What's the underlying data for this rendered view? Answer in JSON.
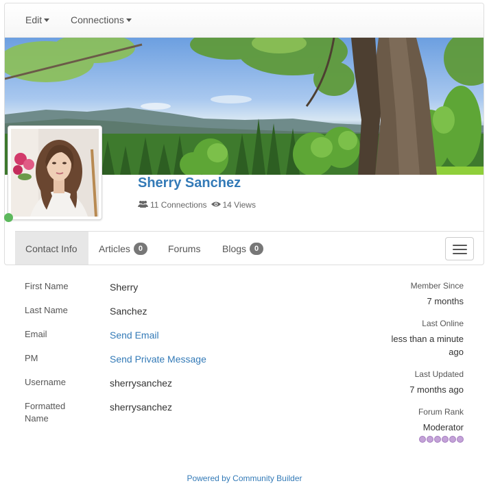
{
  "nav": {
    "edit_label": "Edit",
    "connections_label": "Connections"
  },
  "profile": {
    "name": "Sherry Sanchez",
    "connections_text": "11 Connections",
    "views_text": "14 Views",
    "online": true
  },
  "tabs": [
    {
      "label": "Contact Info",
      "badge": null,
      "active": true
    },
    {
      "label": "Articles",
      "badge": "0",
      "active": false
    },
    {
      "label": "Forums",
      "badge": null,
      "active": false
    },
    {
      "label": "Blogs",
      "badge": "0",
      "active": false
    }
  ],
  "fields": [
    {
      "label": "First Name",
      "value": "Sherry"
    },
    {
      "label": "Last Name",
      "value": "Sanchez"
    },
    {
      "label": "Email",
      "value": "Send Email"
    },
    {
      "label": "PM",
      "value": "Send Private Message"
    },
    {
      "label": "Username",
      "value": "sherrysanchez"
    },
    {
      "label": "Formatted Name",
      "value": "sherrysanchez"
    }
  ],
  "sidebar": {
    "member_since_label": "Member Since",
    "member_since_value": "7 months",
    "last_online_label": "Last Online",
    "last_online_value": "less than a minute ago",
    "last_updated_label": "Last Updated",
    "last_updated_value": "7 months ago",
    "forum_rank_label": "Forum Rank",
    "forum_rank_value": "Moderator",
    "rank_stars": 6
  },
  "footer": {
    "text": "Powered by Community Builder"
  },
  "colors": {
    "link": "#337ab7",
    "online": "#5cb85c",
    "badge": "#777777",
    "rank": "#c4a3d8"
  },
  "icons": {
    "connections": "users-icon",
    "views": "eye-icon",
    "menu": "hamburger-icon"
  }
}
